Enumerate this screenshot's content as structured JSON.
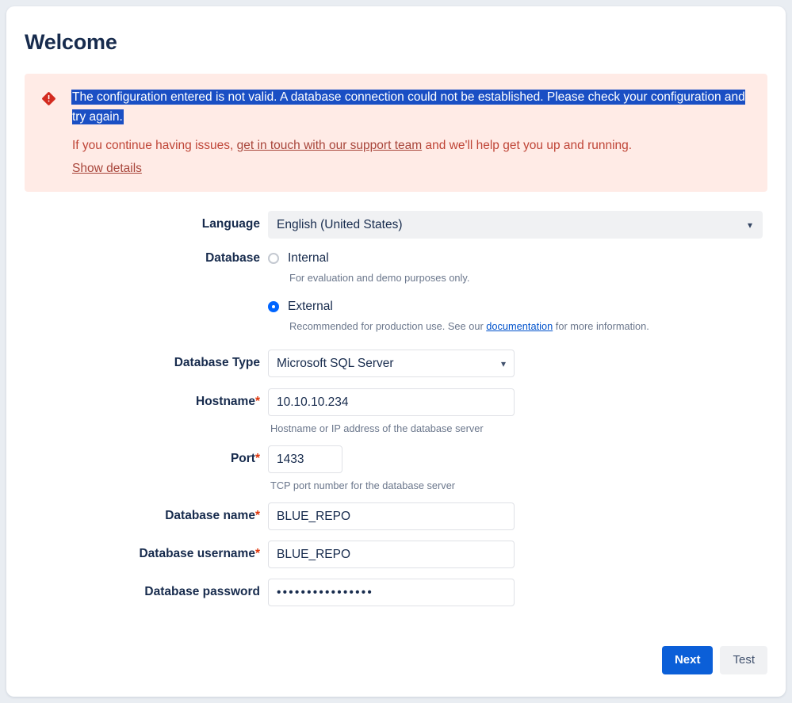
{
  "page": {
    "title": "Welcome"
  },
  "error": {
    "icon": "error-diamond-icon",
    "message": "The configuration entered is not valid. A database connection could not be established. Please check your configuration and try again.",
    "support_prefix": "If you continue having issues, ",
    "support_link": "get in touch with our support team",
    "support_suffix": " and we'll help get you up and running.",
    "show_details_label": "Show details",
    "background_color": "#ffebe6",
    "selection_color": "#1a4fc4",
    "text_color": "#bf4436"
  },
  "form": {
    "language": {
      "label": "Language",
      "value": "English (United States)",
      "chevron": "chevron-down-icon"
    },
    "database": {
      "label": "Database",
      "options": [
        {
          "label": "Internal",
          "selected": false,
          "note": "For evaluation and demo purposes only."
        },
        {
          "label": "External",
          "selected": true,
          "note_prefix": "Recommended for production use. See our ",
          "note_link": "documentation",
          "note_suffix": " for more information."
        }
      ]
    },
    "database_type": {
      "label": "Database Type",
      "value": "Microsoft SQL Server",
      "chevron": "chevron-down-icon"
    },
    "hostname": {
      "label": "Hostname",
      "required": "*",
      "value": "10.10.10.234",
      "hint": "Hostname or IP address of the database server"
    },
    "port": {
      "label": "Port",
      "required": "*",
      "value": "1433",
      "hint": "TCP port number for the database server"
    },
    "database_name": {
      "label": "Database name",
      "required": "*",
      "value": "BLUE_REPO"
    },
    "database_username": {
      "label": "Database username",
      "required": "*",
      "value": "BLUE_REPO"
    },
    "database_password": {
      "label": "Database password",
      "value": "••••••••••••••••"
    }
  },
  "footer": {
    "next_label": "Next",
    "test_label": "Test",
    "primary_color": "#0b5fd8"
  }
}
